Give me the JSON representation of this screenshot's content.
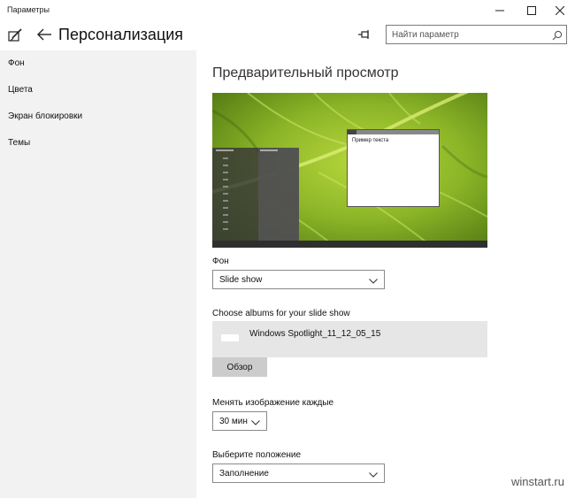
{
  "window": {
    "title": "Параметры"
  },
  "header": {
    "page_title": "Персонализация",
    "search_placeholder": "Найти параметр"
  },
  "sidebar": {
    "items": [
      {
        "label": "Фон"
      },
      {
        "label": "Цвета"
      },
      {
        "label": "Экран блокировки"
      },
      {
        "label": "Темы"
      }
    ]
  },
  "main": {
    "section_title": "Предварительный просмотр",
    "preview": {
      "sample_text": "Пример текста"
    },
    "background": {
      "label": "Фон",
      "value": "Slide show"
    },
    "albums": {
      "label": "Choose albums for your slide show",
      "album_name": "Windows Spotlight_11_12_05_15",
      "browse_label": "Обзор"
    },
    "interval": {
      "label": "Менять изображение каждые",
      "value": "30 мин"
    },
    "fit": {
      "label": "Выберите положение",
      "value": "Заполнение"
    }
  },
  "watermark": "winstart.ru",
  "colors": {
    "sidebar_bg": "#f2f2f2",
    "album_bg": "#e6e6e6",
    "button_bg": "#cccccc",
    "preview_green": "#6f9a18"
  }
}
